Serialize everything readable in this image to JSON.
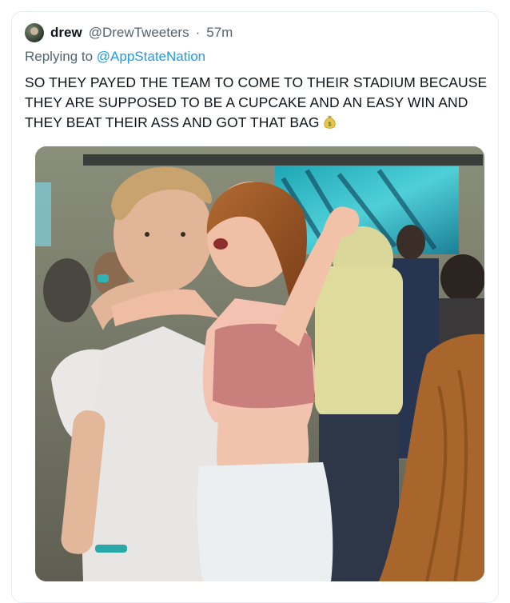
{
  "tweet": {
    "display_name": "drew",
    "handle": "@DrewTweeters",
    "separator": "·",
    "time": "57m",
    "reply_prefix": "Replying to",
    "reply_to": "@AppStateNation",
    "text": "SO THEY PAYED THE TEAM TO COME TO THEIR STADIUM BECAUSE THEY ARE SUPPOSED TO BE A CUPCAKE AND AN EASY WIN AND THEY BEAT THEIR ASS AND GOT THAT BAG",
    "emoji": "money-bag-icon"
  },
  "colors": {
    "link": "#1d9bf0",
    "secondary_text": "#536471",
    "border": "#e6ecf0"
  }
}
